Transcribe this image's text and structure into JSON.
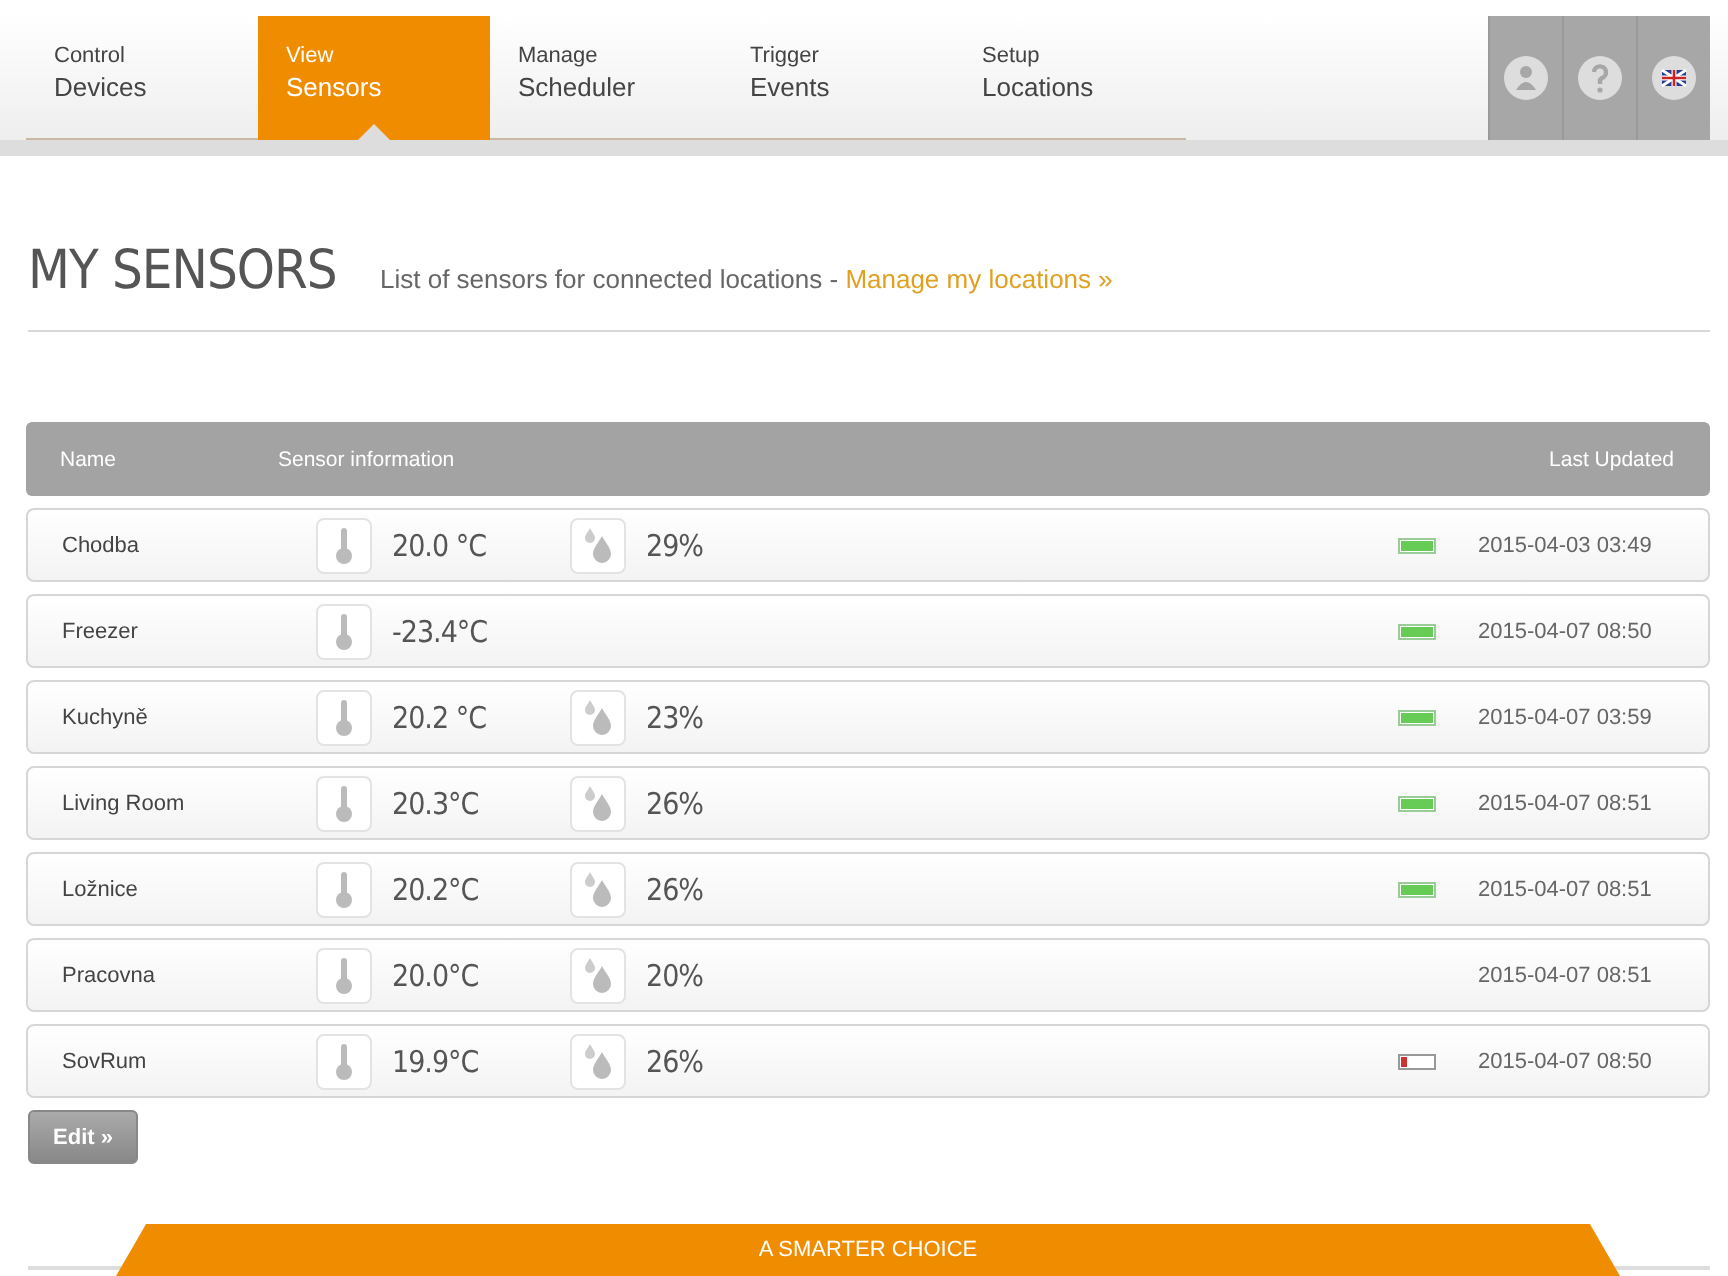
{
  "nav": {
    "tabs": [
      {
        "small": "Control",
        "label": "Devices",
        "selected": false
      },
      {
        "small": "View",
        "label": "Sensors",
        "selected": true
      },
      {
        "small": "Manage",
        "label": "Scheduler",
        "selected": false
      },
      {
        "small": "Trigger",
        "label": "Events",
        "selected": false
      },
      {
        "small": "Setup",
        "label": "Locations",
        "selected": false
      }
    ],
    "icons": [
      {
        "kind": "user"
      },
      {
        "kind": "help"
      },
      {
        "kind": "flag"
      }
    ]
  },
  "heading": {
    "title": "MY SENSORS",
    "subtitle": "List of sensors for connected locations - ",
    "link": "Manage my locations »"
  },
  "table": {
    "columns": [
      "Name",
      "Sensor information",
      "Last Updated"
    ],
    "rows": [
      {
        "name": "Chodba",
        "temperature": "20.0 °C",
        "humidity": "29%",
        "battery_shown": true,
        "battery_low": false,
        "updated": "2015-04-03 03:49"
      },
      {
        "name": "Freezer",
        "temperature": "-23.4°C",
        "battery_shown": true,
        "battery_low": false,
        "updated": "2015-04-07 08:50"
      },
      {
        "name": "Kuchyně",
        "temperature": "20.2 °C",
        "humidity": "23%",
        "battery_shown": true,
        "battery_low": false,
        "updated": "2015-04-07 03:59"
      },
      {
        "name": "Living Room",
        "temperature": "20.3°C",
        "humidity": "26%",
        "battery_shown": true,
        "battery_low": false,
        "updated": "2015-04-07 08:51"
      },
      {
        "name": "Ložnice",
        "temperature": "20.2°C",
        "humidity": "26%",
        "battery_shown": true,
        "battery_low": false,
        "updated": "2015-04-07 08:51"
      },
      {
        "name": "Pracovna",
        "temperature": "20.0°C",
        "humidity": "20%",
        "battery_shown": false,
        "updated": "2015-04-07 08:51"
      },
      {
        "name": "SovRum",
        "temperature": "19.9°C",
        "humidity": "26%",
        "battery_shown": true,
        "battery_low": true,
        "updated": "2015-04-07 08:50"
      }
    ]
  },
  "edit_button": "Edit »",
  "footer": {
    "banner": "A SMARTER CHOICE"
  }
}
